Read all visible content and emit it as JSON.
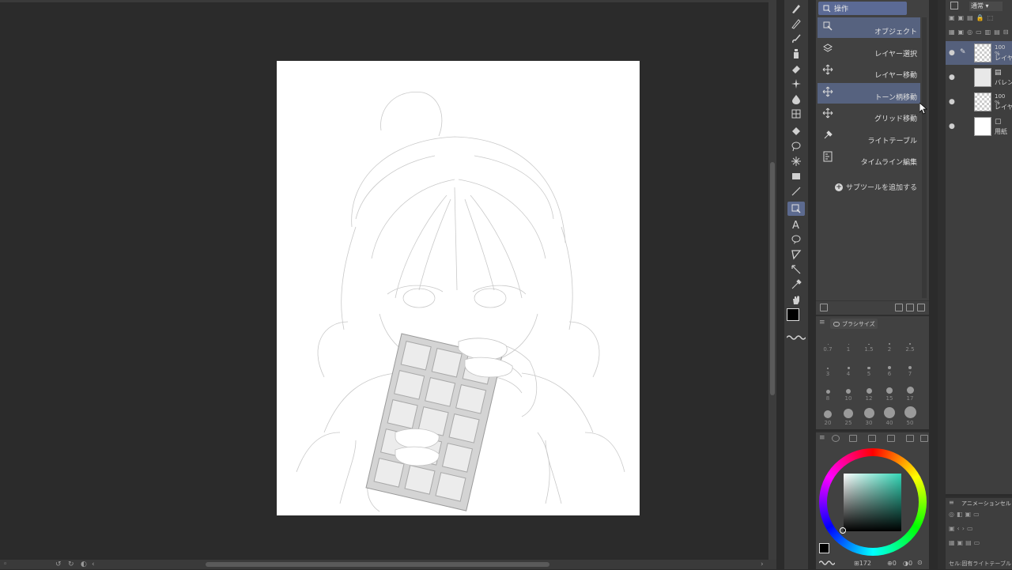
{
  "subtool": {
    "header": "操作",
    "items": [
      {
        "label": "オブジェクト",
        "icon": "object-select-icon",
        "selected": true
      },
      {
        "label": "レイヤー選択",
        "icon": "layer-select-icon",
        "selected": false
      },
      {
        "label": "レイヤー移動",
        "icon": "move-icon",
        "selected": false
      },
      {
        "label": "トーン柄移動",
        "icon": "move-icon",
        "selected": true
      },
      {
        "label": "グリッド移動",
        "icon": "move-icon",
        "selected": false
      },
      {
        "label": "ライトテーブル",
        "icon": "light-table-icon",
        "selected": false
      },
      {
        "label": "タイムライン編集",
        "icon": "timeline-icon",
        "selected": false
      }
    ],
    "add_label": "サブツールを追加する"
  },
  "brush_size": {
    "tab_label": "ブラシサイズ",
    "sizes": [
      "0.7",
      "1",
      "1.5",
      "2",
      "2.5",
      "3",
      "4",
      "5",
      "6",
      "7",
      "8",
      "10",
      "12",
      "15",
      "17",
      "20",
      "25",
      "30",
      "40",
      "50"
    ]
  },
  "color": {
    "main_color": "#000000",
    "sub_color": "#ffffff",
    "hue_color": "#33d6b6",
    "footer_value": "172",
    "footer_value2": "0",
    "footer_value3": "0"
  },
  "layers": {
    "blend_mode": "通常",
    "rows": [
      {
        "opacity": "100 %",
        "name": "レイヤー",
        "selected": true,
        "thumb": "checker"
      },
      {
        "opacity": "",
        "name": "バレンタ",
        "selected": false,
        "thumb": "folder"
      },
      {
        "opacity": "100 %",
        "name": "レイヤー",
        "selected": false,
        "thumb": "checker"
      },
      {
        "opacity": "",
        "name": "用紙",
        "selected": false,
        "thumb": "white"
      }
    ]
  },
  "animation_panel": {
    "title": "アニメーションセル",
    "footer": "セル:固有ライトテーブル"
  },
  "accent_color": "#5b6a95"
}
